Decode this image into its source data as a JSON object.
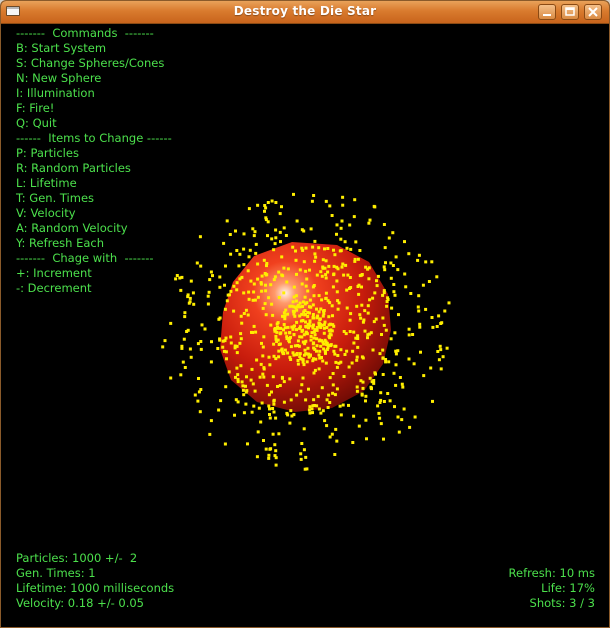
{
  "window": {
    "title": "Destroy the Die Star"
  },
  "menu": {
    "commands_header": "-------  Commands  -------",
    "commands": [
      "B: Start System",
      "S: Change Spheres/Cones",
      "N: New Sphere",
      "I: Illumination",
      "F: Fire!",
      "Q: Quit"
    ],
    "items_header": "------  Items to Change ------",
    "items": [
      "P: Particles",
      "R: Random Particles",
      "L: Lifetime",
      "T: Gen. Times",
      "V: Velocity",
      "A: Random Velocity",
      "Y: Refresh Each"
    ],
    "change_header": "-------  Chage with  -------",
    "change": [
      "+: Increment",
      "-: Decrement"
    ]
  },
  "status": {
    "particles": "Particles: 1000 +/-  2",
    "gen_times": "Gen. Times: 1",
    "lifetime": "Lifetime: 1000 milliseconds",
    "velocity": "Velocity: 0.18 +/- 0.05",
    "refresh": "Refresh: 10 ms",
    "life": "Life: 17%",
    "shots": "Shots: 3 / 3"
  },
  "colors": {
    "text": "#4ce04c",
    "background": "#000000",
    "particle": "#ffee00",
    "sphere": "#d42a10",
    "titlebar": "#d97b2e"
  },
  "icons": {
    "window": "window-icon",
    "minimize": "minimize-icon",
    "maximize": "maximize-icon",
    "close": "close-icon"
  }
}
